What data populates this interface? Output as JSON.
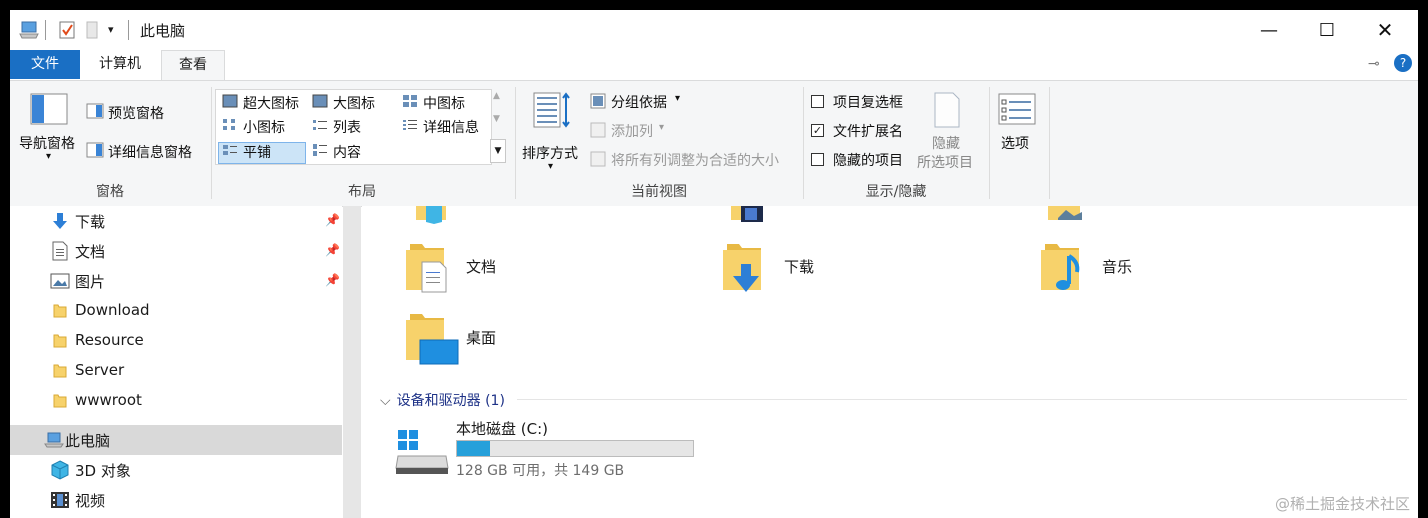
{
  "window": {
    "title": "此电脑",
    "controls": [
      "minimize-icon",
      "maximize-icon",
      "close-icon"
    ]
  },
  "ribbon_tabs": {
    "file": "文件",
    "computer": "计算机",
    "view": "查看"
  },
  "ribbon": {
    "panes": {
      "nav_pane": "导航窗格",
      "preview": "预览窗格",
      "details": "详细信息窗格",
      "group": "窗格"
    },
    "layout": {
      "items": [
        "超大图标",
        "大图标",
        "中图标",
        "小图标",
        "列表",
        "详细信息",
        "平铺",
        "内容"
      ],
      "selected": "平铺",
      "group": "布局"
    },
    "current_view": {
      "sort": "排序方式",
      "group_by": "分组依据",
      "add_column": "添加列",
      "fit_columns": "将所有列调整为合适的大小",
      "group": "当前视图"
    },
    "show_hide": {
      "item_checkboxes": "项目复选框",
      "file_ext": "文件扩展名",
      "hidden_items": "隐藏的项目",
      "hide_line1": "隐藏",
      "hide_line2": "所选项目",
      "group": "显示/隐藏",
      "checked": {
        "item_checkboxes": false,
        "file_ext": true,
        "hidden_items": false
      }
    },
    "options": "选项"
  },
  "nav": {
    "items": [
      {
        "label": "下载",
        "icon": "download-arrow-icon",
        "pinned": true
      },
      {
        "label": "文档",
        "icon": "document-icon",
        "pinned": true
      },
      {
        "label": "图片",
        "icon": "picture-icon",
        "pinned": true
      },
      {
        "label": "Download",
        "icon": "folder-icon",
        "pinned": false
      },
      {
        "label": "Resource",
        "icon": "folder-icon",
        "pinned": false
      },
      {
        "label": "Server",
        "icon": "folder-icon",
        "pinned": false
      },
      {
        "label": "wwwroot",
        "icon": "folder-icon",
        "pinned": false
      },
      {
        "label": "此电脑",
        "icon": "computer-icon",
        "selected": true
      },
      {
        "label": "3D 对象",
        "icon": "3d-object-icon"
      },
      {
        "label": "视频",
        "icon": "video-icon"
      }
    ]
  },
  "content": {
    "folders": [
      {
        "label": "文档",
        "icon": "documents-folder-icon"
      },
      {
        "label": "下载",
        "icon": "downloads-folder-icon"
      },
      {
        "label": "音乐",
        "icon": "music-folder-icon"
      },
      {
        "label": "桌面",
        "icon": "desktop-folder-icon"
      }
    ],
    "devices_header": "设备和驱动器 (1)",
    "drive": {
      "label": "本地磁盘 (C:)",
      "free_text": "128 GB 可用，共 149 GB",
      "used_fraction": 0.141,
      "icon": "windows-drive-icon"
    }
  },
  "watermark": "@稀土掘金技术社区",
  "colors": {
    "accent": "#1a6fc4",
    "folder": "#f7d26b",
    "progress": "#26a0da",
    "selected_row": "#d9d9d9"
  }
}
